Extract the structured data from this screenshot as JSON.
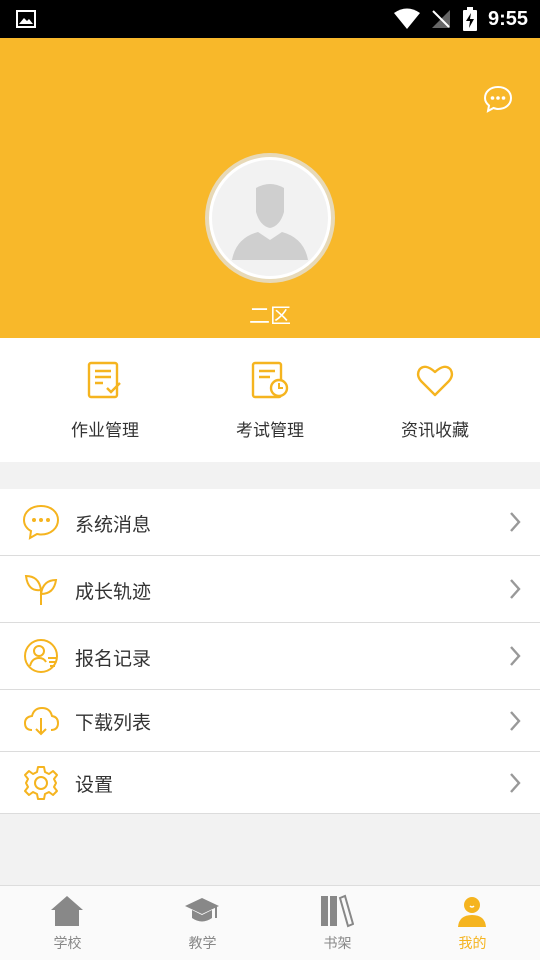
{
  "status_bar": {
    "time": "9:55"
  },
  "header": {
    "username": "二区",
    "bg_color": "#f8b82a"
  },
  "quick_actions": [
    {
      "label": "作业管理",
      "icon": "homework-list-icon"
    },
    {
      "label": "考试管理",
      "icon": "exam-clock-icon"
    },
    {
      "label": "资讯收藏",
      "icon": "heart-icon"
    }
  ],
  "menu": [
    {
      "label": "系统消息",
      "icon": "chat-bubble-icon"
    },
    {
      "label": "成长轨迹",
      "icon": "sprout-icon"
    },
    {
      "label": "报名记录",
      "icon": "user-record-icon"
    },
    {
      "label": "下载列表",
      "icon": "cloud-download-icon"
    },
    {
      "label": "设置",
      "icon": "gear-icon"
    }
  ],
  "tabs": [
    {
      "label": "学校",
      "icon": "house-icon",
      "active": false
    },
    {
      "label": "教学",
      "icon": "graduation-cap-icon",
      "active": false
    },
    {
      "label": "书架",
      "icon": "bookshelf-icon",
      "active": false
    },
    {
      "label": "我的",
      "icon": "person-icon",
      "active": true
    }
  ],
  "colors": {
    "accent": "#f5b41f",
    "inactive_tab": "#888888"
  }
}
